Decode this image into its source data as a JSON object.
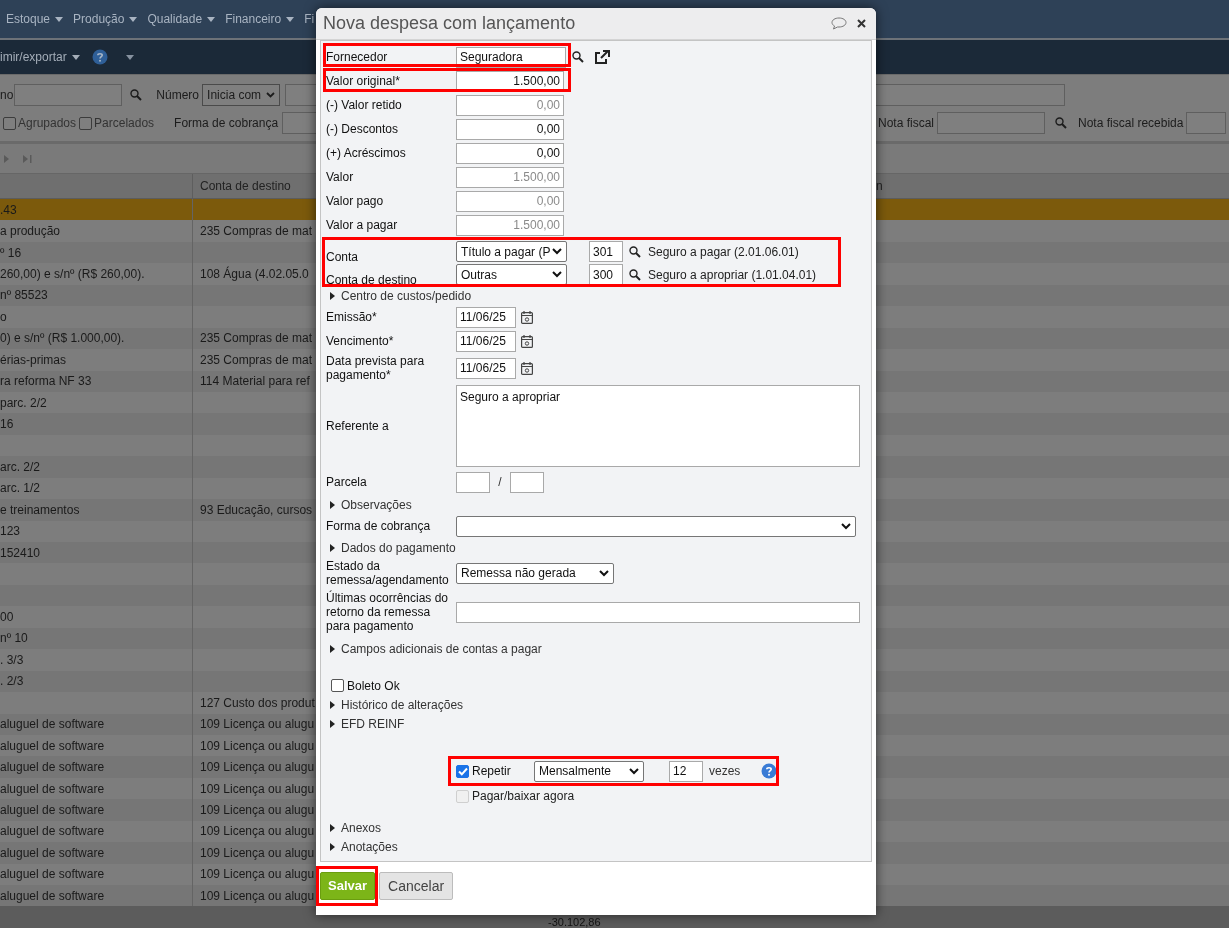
{
  "background": {
    "nav_menu": [
      {
        "label": "Estoque",
        "caret": true
      },
      {
        "label": "Produção",
        "caret": true
      },
      {
        "label": "Qualidade",
        "caret": true
      },
      {
        "label": "Financeiro",
        "caret": true
      },
      {
        "label": "Fi",
        "caret": false
      }
    ],
    "toolbar": {
      "label": "imir/exportar"
    },
    "filters": {
      "row_1": {
        "label": "no",
        "number_label": "Número",
        "number_mode": "Inicia com"
      },
      "row_2": {
        "checkboxes": [
          {
            "label": "Agrupados",
            "checked": false
          },
          {
            "label": "Parcelados",
            "checked": false
          }
        ],
        "billing_label": "Forma de cobrança",
        "invoice_label": "Nota fiscal",
        "received_invoice_label": "Nota fiscal recebida"
      }
    },
    "grid": {
      "column_2": "Conta de destino",
      "column_3": "n",
      "rows": [
        {
          "cells": [
            ".43",
            ""
          ],
          "selected": true
        },
        {
          "cells": [
            "a produção",
            "235 Compras de mat"
          ],
          "selected": false
        },
        {
          "cells": [
            "º 16",
            ""
          ],
          "selected": false
        },
        {
          "cells": [
            "260,00) e s/nº (R$ 260,00).",
            "108 Água (4.02.05.0"
          ],
          "selected": false
        },
        {
          "cells": [
            "nº 85523",
            ""
          ],
          "selected": false
        },
        {
          "cells": [
            "o",
            ""
          ],
          "selected": false
        },
        {
          "cells": [
            "0) e s/nº (R$ 1.000,00).",
            "235 Compras de mat"
          ],
          "selected": false
        },
        {
          "cells": [
            "érias-primas",
            "235 Compras de mat"
          ],
          "selected": false
        },
        {
          "cells": [
            "ra reforma NF 33",
            "114 Material para ref"
          ],
          "selected": false
        },
        {
          "cells": [
            "parc. 2/2",
            ""
          ],
          "selected": false
        },
        {
          "cells": [
            "16",
            ""
          ],
          "selected": false
        },
        {
          "cells": [
            "",
            ""
          ],
          "selected": false
        },
        {
          "cells": [
            "arc. 2/2",
            ""
          ],
          "selected": false
        },
        {
          "cells": [
            "arc. 1/2",
            ""
          ],
          "selected": false
        },
        {
          "cells": [
            "e treinamentos",
            "93 Educação, cursos"
          ],
          "selected": false
        },
        {
          "cells": [
            "123",
            ""
          ],
          "selected": false
        },
        {
          "cells": [
            "152410",
            ""
          ],
          "selected": false
        },
        {
          "cells": [
            "",
            ""
          ],
          "selected": false
        },
        {
          "cells": [
            "",
            ""
          ],
          "selected": false
        },
        {
          "cells": [
            "00",
            ""
          ],
          "selected": false
        },
        {
          "cells": [
            "nº 10",
            ""
          ],
          "selected": false
        },
        {
          "cells": [
            ". 3/3",
            ""
          ],
          "selected": false
        },
        {
          "cells": [
            ". 2/3",
            ""
          ],
          "selected": false
        },
        {
          "cells": [
            "",
            "127 Custo dos produt"
          ],
          "selected": false
        },
        {
          "cells": [
            "aluguel de software",
            "109 Licença ou alugu"
          ],
          "selected": false
        },
        {
          "cells": [
            "aluguel de software",
            "109 Licença ou alugu"
          ],
          "selected": false
        },
        {
          "cells": [
            "aluguel de software",
            "109 Licença ou alugu"
          ],
          "selected": false
        },
        {
          "cells": [
            "aluguel de software",
            "109 Licença ou alugu"
          ],
          "selected": false
        },
        {
          "cells": [
            "aluguel de software",
            "109 Licença ou alugu"
          ],
          "selected": false
        },
        {
          "cells": [
            "aluguel de software",
            "109 Licença ou alugu"
          ],
          "selected": false
        },
        {
          "cells": [
            "aluguel de software",
            "109 Licença ou alugu"
          ],
          "selected": false
        },
        {
          "cells": [
            "aluguel de software",
            "109 Licença ou alugu"
          ],
          "selected": false
        },
        {
          "cells": [
            "aluguel de software",
            "109 Licença ou alugu"
          ],
          "selected": false
        }
      ],
      "total": "-30.102,86"
    }
  },
  "dialog": {
    "title": "Nova despesa com lançamento",
    "groups": [
      [
        {
          "kind": "lookup",
          "label": "Fornecedor",
          "value": "Seguradora",
          "highlighted": true
        },
        {
          "kind": "money",
          "label": "Valor original*",
          "value": "1.500,00",
          "disabled": false,
          "highlighted": true
        },
        {
          "kind": "money",
          "label": "(-) Valor retido",
          "value": "0,00",
          "disabled": true,
          "highlighted": false
        },
        {
          "kind": "money",
          "label": "(-) Descontos",
          "value": "0,00",
          "disabled": false,
          "highlighted": false
        },
        {
          "kind": "money",
          "label": "(+) Acréscimos",
          "value": "0,00",
          "disabled": false,
          "highlighted": false
        },
        {
          "kind": "money",
          "label": "Valor",
          "value": "1.500,00",
          "disabled": true,
          "highlighted": false
        },
        {
          "kind": "money",
          "label": "Valor pago",
          "value": "0,00",
          "disabled": true,
          "highlighted": false
        },
        {
          "kind": "money",
          "label": "Valor a pagar",
          "value": "1.500,00",
          "disabled": true,
          "highlighted": false
        },
        {
          "kind": "accounts",
          "highlighted": true,
          "rows": [
            {
              "label": "Conta",
              "type": "Título a pagar (P",
              "code": "301",
              "description": "Seguro a pagar (2.01.06.01)"
            },
            {
              "label": "Conta de destino",
              "type": "Outras",
              "code": "300",
              "description": "Seguro a apropriar (1.01.04.01)"
            }
          ]
        },
        {
          "kind": "expander",
          "label": "Centro de custos/pedido"
        },
        {
          "kind": "date",
          "label": "Emissão*",
          "value": "11/06/25"
        },
        {
          "kind": "date",
          "label": "Vencimento*",
          "value": "11/06/25"
        },
        {
          "kind": "date",
          "label": "Data prevista para pagamento*",
          "value": "11/06/25"
        },
        {
          "kind": "textarea",
          "label": "Referente a",
          "value": "Seguro a apropriar"
        },
        {
          "kind": "installment",
          "label": "Parcela",
          "separator": "/"
        },
        {
          "kind": "expander",
          "label": "Observações"
        },
        {
          "kind": "select_wide",
          "label": "Forma de cobrança"
        },
        {
          "kind": "expander",
          "label": "Dados do pagamento"
        },
        {
          "kind": "select",
          "label": "Estado da remessa/agendamento",
          "value": "Remessa não gerada"
        },
        {
          "kind": "text_wide",
          "label": "Últimas ocorrências do retorno da remessa para pagamento"
        }
      ],
      [
        {
          "kind": "expander",
          "label": "Campos adicionais de contas a pagar"
        }
      ],
      [
        {
          "kind": "checkbox",
          "label": "Boleto Ok",
          "checked": false,
          "disabled": false
        },
        {
          "kind": "expander",
          "label": "Histórico de alterações"
        },
        {
          "kind": "expander",
          "label": "EFD REINF"
        }
      ],
      [
        {
          "kind": "repeat",
          "label": "Repetir",
          "checked": true,
          "frequency": "Mensalmente",
          "count": "12",
          "unit": "vezes",
          "highlighted": true
        },
        {
          "kind": "checkbox_indented",
          "label": "Pagar/baixar agora",
          "checked": false,
          "disabled": true
        }
      ],
      [
        {
          "kind": "expander",
          "label": "Anexos"
        },
        {
          "kind": "expander",
          "label": "Anotações"
        }
      ]
    ],
    "buttons": [
      {
        "kind": "primary",
        "label": "Salvar",
        "highlighted": true
      },
      {
        "kind": "secondary",
        "label": "Cancelar",
        "highlighted": false
      }
    ]
  }
}
